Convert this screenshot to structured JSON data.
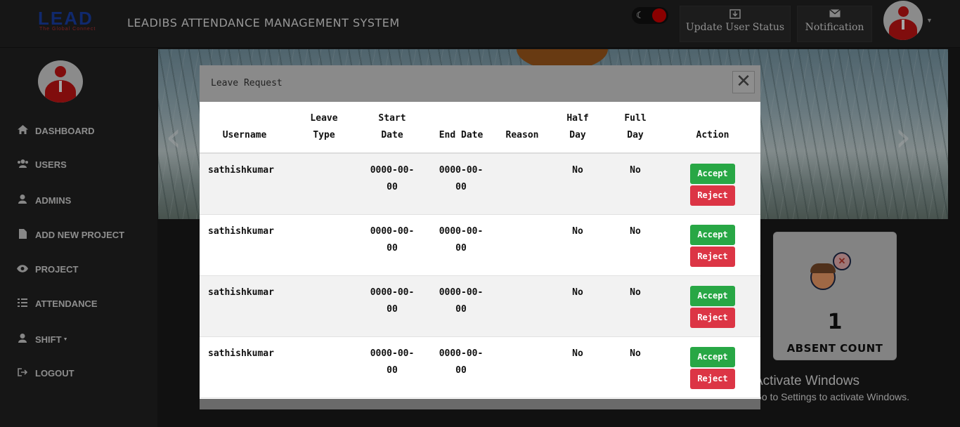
{
  "header": {
    "logo_text": "LEAD",
    "logo_tagline": "The Global Connect",
    "title": "LEADIBS ATTENDANCE MANAGEMENT SYSTEM",
    "update_status_label": "Update User Status",
    "notification_label": "Notification"
  },
  "sidebar": {
    "items": [
      {
        "label": "DASHBOARD",
        "icon": "home-icon"
      },
      {
        "label": "USERS",
        "icon": "users-icon"
      },
      {
        "label": "ADMINS",
        "icon": "user-icon"
      },
      {
        "label": "ADD NEW PROJECT",
        "icon": "file-icon"
      },
      {
        "label": "PROJECT",
        "icon": "eye-icon"
      },
      {
        "label": "ATTENDANCE",
        "icon": "list-icon"
      },
      {
        "label": "SHIFT",
        "icon": "user-icon"
      },
      {
        "label": "LOGOUT",
        "icon": "logout-icon"
      }
    ]
  },
  "absent_card": {
    "count": "1",
    "label": "ABSENT COUNT"
  },
  "modal": {
    "title": "Leave Request",
    "close_glyph": "✕",
    "columns": {
      "username": "Username",
      "leave_type_1": "Leave",
      "leave_type_2": "Type",
      "start_date_1": "Start",
      "start_date_2": "Date",
      "end_date": "End Date",
      "reason": "Reason",
      "half_day_1": "Half",
      "half_day_2": "Day",
      "full_day_1": "Full",
      "full_day_2": "Day",
      "action": "Action"
    },
    "accept_label": "Accept",
    "reject_label": "Reject",
    "rows": [
      {
        "username": "sathishkumar",
        "leave_type": "",
        "start_1": "0000-00-",
        "start_2": "00",
        "end_1": "0000-00-",
        "end_2": "00",
        "reason": "",
        "half_day": "No",
        "full_day": "No"
      },
      {
        "username": "sathishkumar",
        "leave_type": "",
        "start_1": "0000-00-",
        "start_2": "00",
        "end_1": "0000-00-",
        "end_2": "00",
        "reason": "",
        "half_day": "No",
        "full_day": "No"
      },
      {
        "username": "sathishkumar",
        "leave_type": "",
        "start_1": "0000-00-",
        "start_2": "00",
        "end_1": "0000-00-",
        "end_2": "00",
        "reason": "",
        "half_day": "No",
        "full_day": "No"
      },
      {
        "username": "sathishkumar",
        "leave_type": "",
        "start_1": "0000-00-",
        "start_2": "00",
        "end_1": "0000-00-",
        "end_2": "00",
        "reason": "",
        "half_day": "No",
        "full_day": "No"
      }
    ]
  },
  "watermark": {
    "line1": "Activate Windows",
    "line2": "Go to Settings to activate Windows."
  },
  "colors": {
    "accept": "#28a745",
    "reject": "#dc3545",
    "toggle_knob": "#d40000",
    "avatar_figure": "#c51515"
  }
}
